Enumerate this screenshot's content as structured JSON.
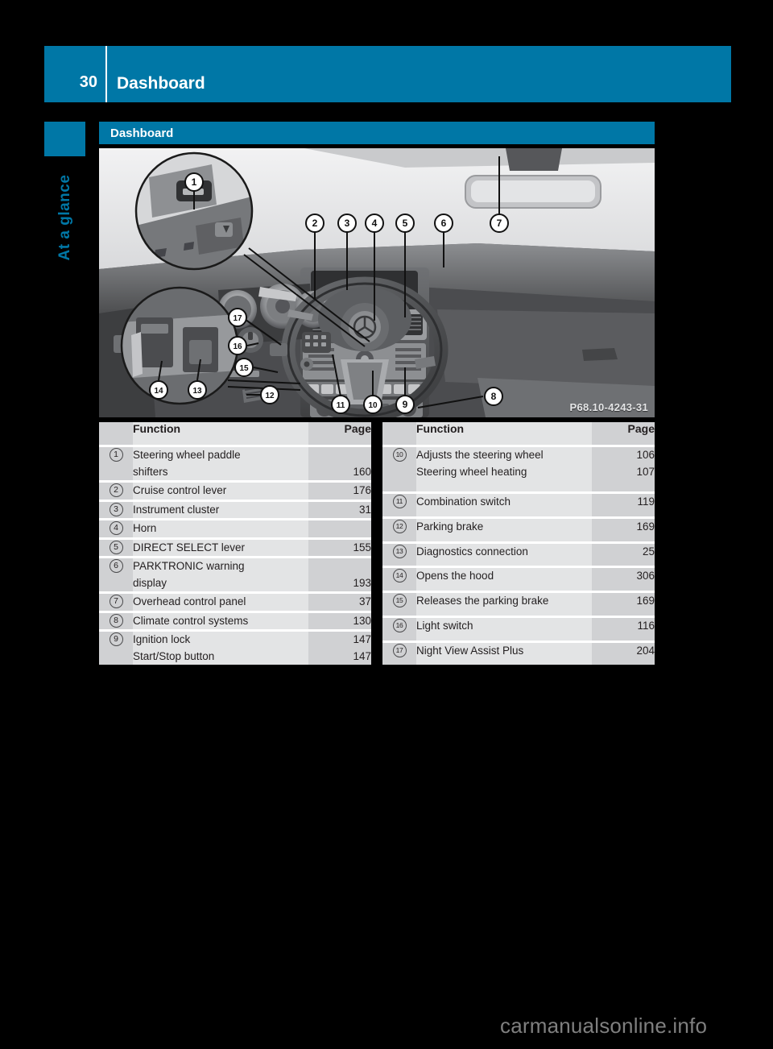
{
  "header": {
    "page_number": "30",
    "title": "Dashboard"
  },
  "sidebar": {
    "label": "At a glance"
  },
  "section": {
    "title": "Dashboard"
  },
  "illustration": {
    "caption": "P68.10-4243-31",
    "callouts": [
      "1",
      "2",
      "3",
      "4",
      "5",
      "6",
      "7",
      "8",
      "9",
      "10",
      "11",
      "12",
      "13",
      "14",
      "15",
      "16",
      "17"
    ]
  },
  "tables": {
    "columns": {
      "num": "",
      "function": "Function",
      "page": "Page"
    },
    "left": [
      {
        "num": "1",
        "function": [
          "Steering wheel paddle",
          "shifters"
        ],
        "page": [
          "",
          "160"
        ]
      },
      {
        "num": "2",
        "function": [
          "Cruise control lever"
        ],
        "page": [
          "176"
        ]
      },
      {
        "num": "3",
        "function": [
          "Instrument cluster"
        ],
        "page": [
          "31"
        ]
      },
      {
        "num": "4",
        "function": [
          "Horn"
        ],
        "page": [
          ""
        ]
      },
      {
        "num": "5",
        "function": [
          "DIRECT SELECT lever"
        ],
        "page": [
          "155"
        ]
      },
      {
        "num": "6",
        "function": [
          "PARKTRONIC warning",
          "display"
        ],
        "page": [
          "",
          "193"
        ]
      },
      {
        "num": "7",
        "function": [
          "Overhead control panel"
        ],
        "page": [
          "37"
        ]
      },
      {
        "num": "8",
        "function": [
          "Climate control systems"
        ],
        "page": [
          "130"
        ]
      },
      {
        "num": "9",
        "function": [
          "Ignition lock",
          "Start/Stop button"
        ],
        "page": [
          "147",
          "147"
        ]
      }
    ],
    "right": [
      {
        "num": "10",
        "function": [
          "Adjusts the steering wheel",
          "Steering wheel heating"
        ],
        "page": [
          "106",
          "107"
        ]
      },
      {
        "num": "11",
        "function": [
          "Combination switch"
        ],
        "page": [
          "119"
        ]
      },
      {
        "num": "12",
        "function": [
          "Parking brake"
        ],
        "page": [
          "169"
        ]
      },
      {
        "num": "13",
        "function": [
          "Diagnostics connection"
        ],
        "page": [
          "25"
        ]
      },
      {
        "num": "14",
        "function": [
          "Opens the hood"
        ],
        "page": [
          "306"
        ]
      },
      {
        "num": "15",
        "function": [
          "Releases the parking brake"
        ],
        "page": [
          "169"
        ]
      },
      {
        "num": "16",
        "function": [
          "Light switch"
        ],
        "page": [
          "116"
        ]
      },
      {
        "num": "17",
        "function": [
          "Night View Assist Plus"
        ],
        "page": [
          "204"
        ]
      }
    ]
  },
  "watermark": {
    "text": "carmanualsonline.info"
  },
  "colors": {
    "brand_blue": "#0077a6",
    "page_background": "#000000",
    "table_num_bg": "#d0d1d3",
    "table_fn_bg": "#e3e4e5",
    "text": "#231f20"
  }
}
